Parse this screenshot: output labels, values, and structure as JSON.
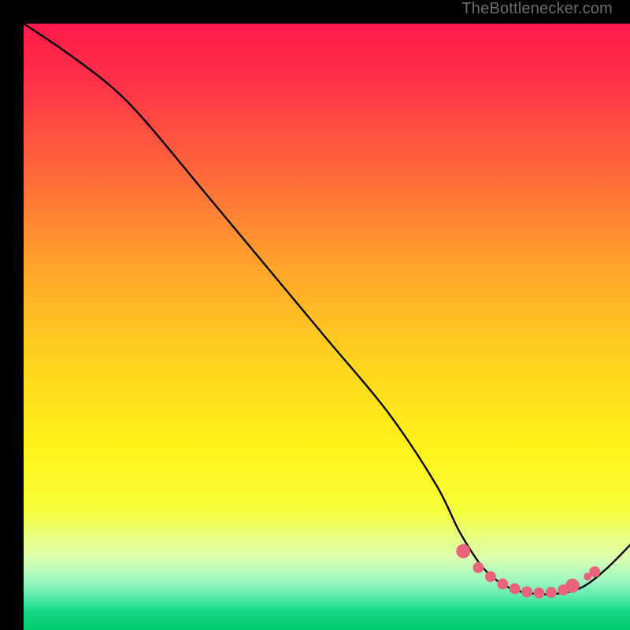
{
  "attribution": "TheBottlenecker.com",
  "chart_data": {
    "type": "line",
    "title": "",
    "xlabel": "",
    "ylabel": "",
    "xlim": [
      0,
      100
    ],
    "ylim": [
      0,
      100
    ],
    "series": [
      {
        "name": "bottleneck-curve",
        "x": [
          0,
          6,
          14,
          20,
          30,
          40,
          50,
          60,
          68,
          72,
          76,
          80,
          84,
          88,
          92,
          96,
          100
        ],
        "y": [
          100,
          96,
          90,
          84,
          72,
          60,
          48,
          36,
          24,
          16,
          10,
          7,
          6,
          6,
          7,
          10,
          14
        ]
      }
    ],
    "markers": {
      "name": "highlight-dots",
      "color": "#e9637a",
      "points": [
        {
          "x": 72.5,
          "y": 13.0,
          "r": 9
        },
        {
          "x": 75.0,
          "y": 10.3,
          "r": 7
        },
        {
          "x": 77.0,
          "y": 8.8,
          "r": 7
        },
        {
          "x": 79.0,
          "y": 7.6,
          "r": 7
        },
        {
          "x": 81.0,
          "y": 6.8,
          "r": 7
        },
        {
          "x": 83.0,
          "y": 6.3,
          "r": 7
        },
        {
          "x": 85.0,
          "y": 6.1,
          "r": 7
        },
        {
          "x": 87.0,
          "y": 6.2,
          "r": 7
        },
        {
          "x": 89.0,
          "y": 6.6,
          "r": 7
        },
        {
          "x": 90.5,
          "y": 7.3,
          "r": 9
        },
        {
          "x": 93.0,
          "y": 8.8,
          "r": 5
        },
        {
          "x": 94.2,
          "y": 9.6,
          "r": 7
        }
      ]
    },
    "gradient_bands": [
      {
        "stop": 0.0,
        "color": "#ff1a4b"
      },
      {
        "stop": 0.1,
        "color": "#ff3249"
      },
      {
        "stop": 0.25,
        "color": "#ff6a3a"
      },
      {
        "stop": 0.4,
        "color": "#ffa32c"
      },
      {
        "stop": 0.55,
        "color": "#ffd21e"
      },
      {
        "stop": 0.7,
        "color": "#fff219"
      },
      {
        "stop": 0.8,
        "color": "#f8ff3a"
      },
      {
        "stop": 0.88,
        "color": "#dcffb0"
      },
      {
        "stop": 0.92,
        "color": "#9cf7c2"
      },
      {
        "stop": 0.95,
        "color": "#4de8a8"
      },
      {
        "stop": 0.97,
        "color": "#15d884"
      },
      {
        "stop": 1.0,
        "color": "#03c96e"
      }
    ]
  }
}
